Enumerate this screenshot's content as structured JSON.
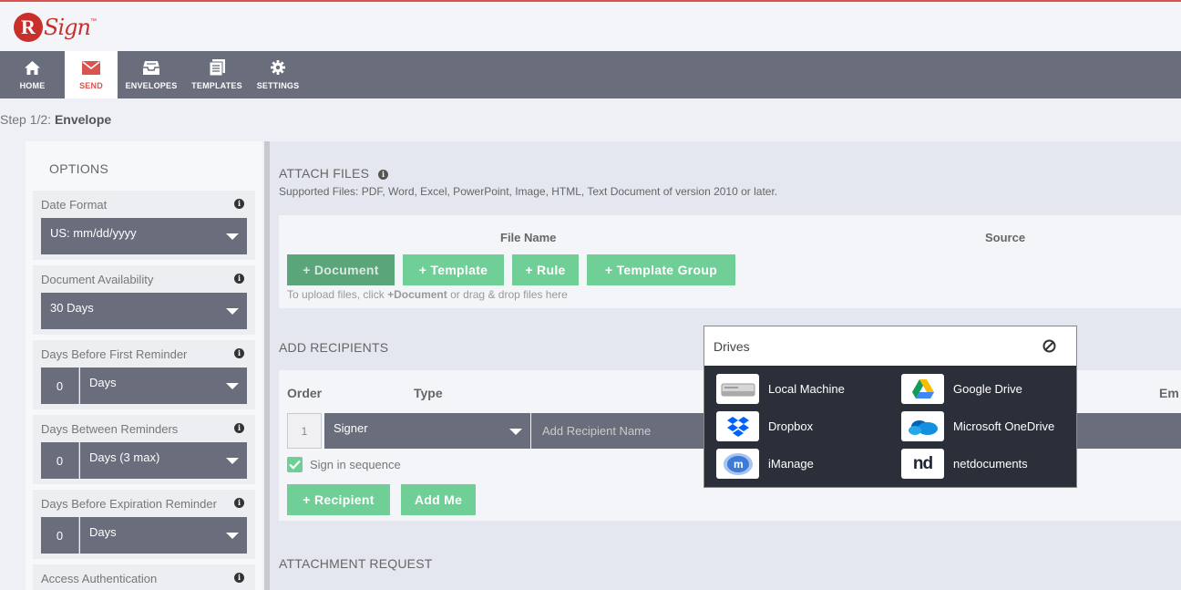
{
  "app": {
    "logo_letter": "R",
    "logo_text": "Sign",
    "logo_trademark": "™"
  },
  "nav": {
    "items": [
      {
        "label": "HOME",
        "icon": "home-icon"
      },
      {
        "label": "SEND",
        "icon": "envelope-icon",
        "active": true
      },
      {
        "label": "ENVELOPES",
        "icon": "inbox-icon"
      },
      {
        "label": "TEMPLATES",
        "icon": "document-icon"
      },
      {
        "label": "SETTINGS",
        "icon": "gear-icon"
      }
    ]
  },
  "step": {
    "prefix": "Step 1/2: ",
    "name": "Envelope"
  },
  "options": {
    "title": "OPTIONS",
    "date_format": {
      "label": "Date Format",
      "value": "US: mm/dd/yyyy"
    },
    "doc_availability": {
      "label": "Document Availability",
      "value": "30 Days"
    },
    "first_reminder": {
      "label": "Days Before First Reminder",
      "number": "0",
      "unit": "Days"
    },
    "between_reminders": {
      "label": "Days Between Reminders",
      "number": "0",
      "unit": "Days (3 max)"
    },
    "expiration_reminder": {
      "label": "Days Before Expiration Reminder",
      "number": "0",
      "unit": "Days"
    },
    "access_auth": {
      "label": "Access Authentication"
    }
  },
  "attach": {
    "title": "ATTACH FILES",
    "supported": "Supported Files: PDF, Word, Excel, PowerPoint, Image, HTML, Text Document of version 2010 or later.",
    "col_file_name": "File Name",
    "col_source": "Source",
    "btn_document": "+ Document",
    "btn_template": "+ Template",
    "btn_rule": "+ Rule",
    "btn_template_group": "+ Template Group",
    "hint_pre": "To upload files, click ",
    "hint_bold": "+Document",
    "hint_post": " or drag & drop files here"
  },
  "recipients": {
    "title": "ADD RECIPIENTS",
    "col_order": "Order",
    "col_type": "Type",
    "col_email": "Em",
    "order": "1",
    "type": "Signer",
    "name_placeholder": "Add Recipient Name",
    "sequence_label": "Sign in sequence",
    "btn_recipient": "+ Recipient",
    "btn_add_me": "Add Me"
  },
  "attachment_request": {
    "title": "ATTACHMENT REQUEST"
  },
  "drives": {
    "title": "Drives",
    "items": [
      {
        "label": "Local Machine",
        "icon": "hard-drive-icon"
      },
      {
        "label": "Google Drive",
        "icon": "google-drive-icon"
      },
      {
        "label": "Dropbox",
        "icon": "dropbox-icon"
      },
      {
        "label": "Microsoft OneDrive",
        "icon": "onedrive-icon"
      },
      {
        "label": "iManage",
        "icon": "imanage-icon"
      },
      {
        "label": "netdocuments",
        "icon": "netdocuments-icon"
      }
    ],
    "netdocs_logo": "nd"
  },
  "colors": {
    "accent_red": "#d9534f",
    "nav_gray": "#6a6d7b",
    "button_green": "#6fcf97"
  }
}
